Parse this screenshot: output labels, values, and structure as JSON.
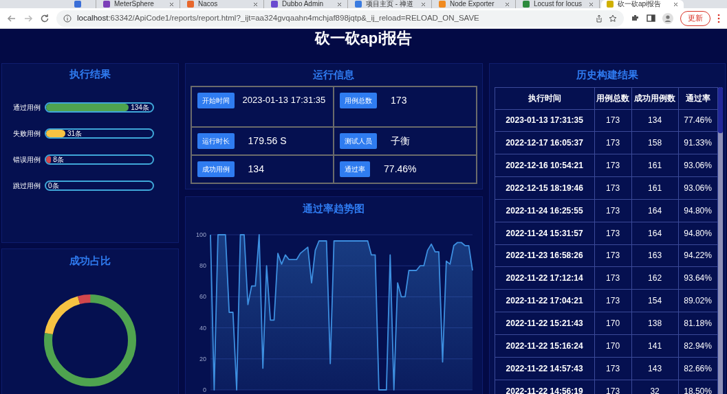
{
  "browser": {
    "tabs": [
      {
        "selected": false
      },
      {
        "title": "MeterSphere",
        "selected": false
      },
      {
        "title": "Nacos",
        "selected": false
      },
      {
        "title": "Dubbo Admin",
        "selected": false
      },
      {
        "title": "项目主页 - 禅道",
        "selected": false
      },
      {
        "title": "Node Exporter",
        "selected": false
      },
      {
        "title": "Locust for locus",
        "selected": false
      },
      {
        "title": "砍一砍api报告",
        "selected": true
      }
    ],
    "url_host": "localhost",
    "url_rest": ":63342/ApiCode1/reports/report.html?_ijt=aa324gvqaahn4mchjaf898jqtp&_ij_reload=RELOAD_ON_SAVE",
    "update_button": "更新"
  },
  "page_title": "砍一砍api报告",
  "results": {
    "title": "执行结果",
    "bars": [
      {
        "label": "通过用例",
        "count": "134条",
        "level": 0.775,
        "color": "#4fa34f"
      },
      {
        "label": "失败用例",
        "count": "31条",
        "level": 0.18,
        "color": "#f7c342"
      },
      {
        "label": "错误用例",
        "count": "8条",
        "level": 0.046,
        "color": "#d1474c"
      },
      {
        "label": "跳过用例",
        "count": "0条",
        "level": 0
      }
    ]
  },
  "share": {
    "title": "成功占比"
  },
  "run_info": {
    "title": "运行信息",
    "fields": [
      {
        "label": "开始时间",
        "value": "2023-01-13 17:31:35"
      },
      {
        "label": "用例总数",
        "value": "173"
      },
      {
        "label": "运行时长",
        "value": "179.56 S"
      },
      {
        "label": "测试人员",
        "value": "子衡"
      },
      {
        "label": "成功用例",
        "value": "134"
      },
      {
        "label": "通过率",
        "value": "77.46%"
      }
    ]
  },
  "trend": {
    "title": "通过率趋势图",
    "chart_data": {
      "type": "area",
      "grid": true,
      "ylim": [
        0,
        100
      ],
      "yticks": [
        0,
        20,
        40,
        60,
        80,
        100
      ],
      "series": [
        {
          "color": "#3d8fe0",
          "values": [
            100,
            0,
            100,
            100,
            100,
            50,
            50,
            0,
            100,
            100,
            55,
            67,
            67,
            100,
            14,
            80,
            45,
            45,
            88,
            81,
            87,
            84,
            84,
            84,
            88,
            90,
            92,
            69,
            90,
            96,
            96,
            96,
            17,
            96,
            96,
            96,
            96,
            96,
            96,
            96,
            96,
            96,
            96,
            87,
            87,
            0,
            0,
            0,
            87,
            0,
            69,
            60,
            60,
            77,
            77,
            77,
            80,
            80,
            90,
            94,
            89,
            89,
            18,
            83,
            81,
            93,
            95,
            95,
            93,
            93,
            77
          ]
        }
      ]
    }
  },
  "history": {
    "title": "历史构建结果",
    "columns": [
      "执行时间",
      "用例总数",
      "成功用例数",
      "通过率"
    ],
    "rows": [
      [
        "2023-01-13 17:31:35",
        "173",
        "134",
        "77.46%"
      ],
      [
        "2022-12-17 16:05:37",
        "173",
        "158",
        "91.33%"
      ],
      [
        "2022-12-16 10:54:21",
        "173",
        "161",
        "93.06%"
      ],
      [
        "2022-12-15 18:19:46",
        "173",
        "161",
        "93.06%"
      ],
      [
        "2022-11-24 16:25:55",
        "173",
        "164",
        "94.80%"
      ],
      [
        "2022-11-24 15:31:57",
        "173",
        "164",
        "94.80%"
      ],
      [
        "2022-11-23 16:58:26",
        "173",
        "163",
        "94.22%"
      ],
      [
        "2022-11-22 17:12:14",
        "173",
        "162",
        "93.64%"
      ],
      [
        "2022-11-22 17:04:21",
        "173",
        "154",
        "89.02%"
      ],
      [
        "2022-11-22 15:21:43",
        "170",
        "138",
        "81.18%"
      ],
      [
        "2022-11-22 15:16:24",
        "170",
        "141",
        "82.94%"
      ],
      [
        "2022-11-22 14:57:43",
        "173",
        "143",
        "82.66%"
      ],
      [
        "2022-11-22 14:56:19",
        "173",
        "32",
        "18.50%"
      ]
    ]
  }
}
